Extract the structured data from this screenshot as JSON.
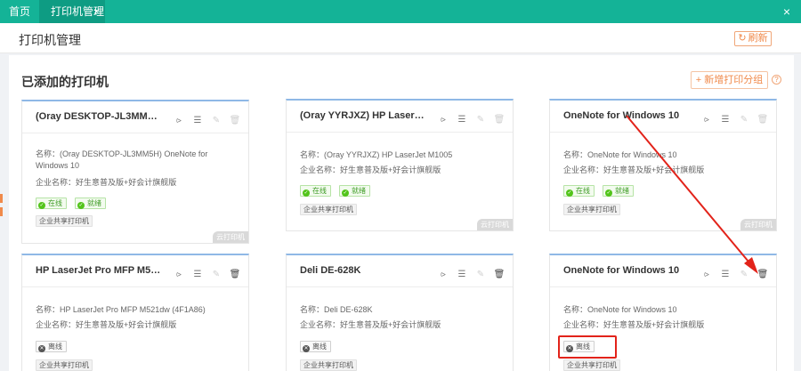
{
  "tabs": {
    "home": "首页",
    "active": "打印机管理",
    "tab_close": "×",
    "bar_close": "×"
  },
  "header": {
    "title": "打印机管理",
    "refresh_label": "刷新",
    "refresh_icon": "↻"
  },
  "section": {
    "title": "已添加的打印机",
    "add_group_label": "新增打印分组",
    "add_icon": "+",
    "help_icon": "?"
  },
  "labels": {
    "name_prefix": "名称：",
    "company_prefix": "企业名称：",
    "online": "在线",
    "ready": "就绪",
    "offline": "离线",
    "shared": "企业共享打印机",
    "cloud": "云打印机"
  },
  "icons": {
    "share": "share-icon",
    "list": "list-icon",
    "edit": "edit-icon",
    "delete": "trash-icon"
  },
  "cards": [
    {
      "title": "(Oray DESKTOP-JL3MM5H) ...",
      "name": "(Oray DESKTOP-JL3MM5H) OneNote for Windows 10",
      "company": "好生意普及版+好会计旗舰版"
    },
    {
      "title": "(Oray YYRJXZ) HP LaserJet ...",
      "name": "(Oray YYRJXZ) HP LaserJet M1005",
      "company": "好生意普及版+好会计旗舰版"
    },
    {
      "title": "OneNote for Windows 10",
      "name": "OneNote for Windows 10",
      "company": "好生意普及版+好会计旗舰版"
    },
    {
      "title": "HP LaserJet Pro MFP M521d...",
      "name": "HP LaserJet Pro MFP M521dw (4F1A86)",
      "company": "好生意普及版+好会计旗舰版"
    },
    {
      "title": "Deli DE-628K",
      "name": "Deli DE-628K",
      "company": "好生意普及版+好会计旗舰版"
    },
    {
      "title": "OneNote for Windows 10",
      "name": "OneNote for Windows 10",
      "company": "好生意普及版+好会计旗舰版"
    }
  ],
  "colors": {
    "accent": "#14b397",
    "tab_active": "#0e9c83",
    "orange": "#f08a4b",
    "annotation": "#e2231a",
    "card_top": "#8fb8e6"
  }
}
